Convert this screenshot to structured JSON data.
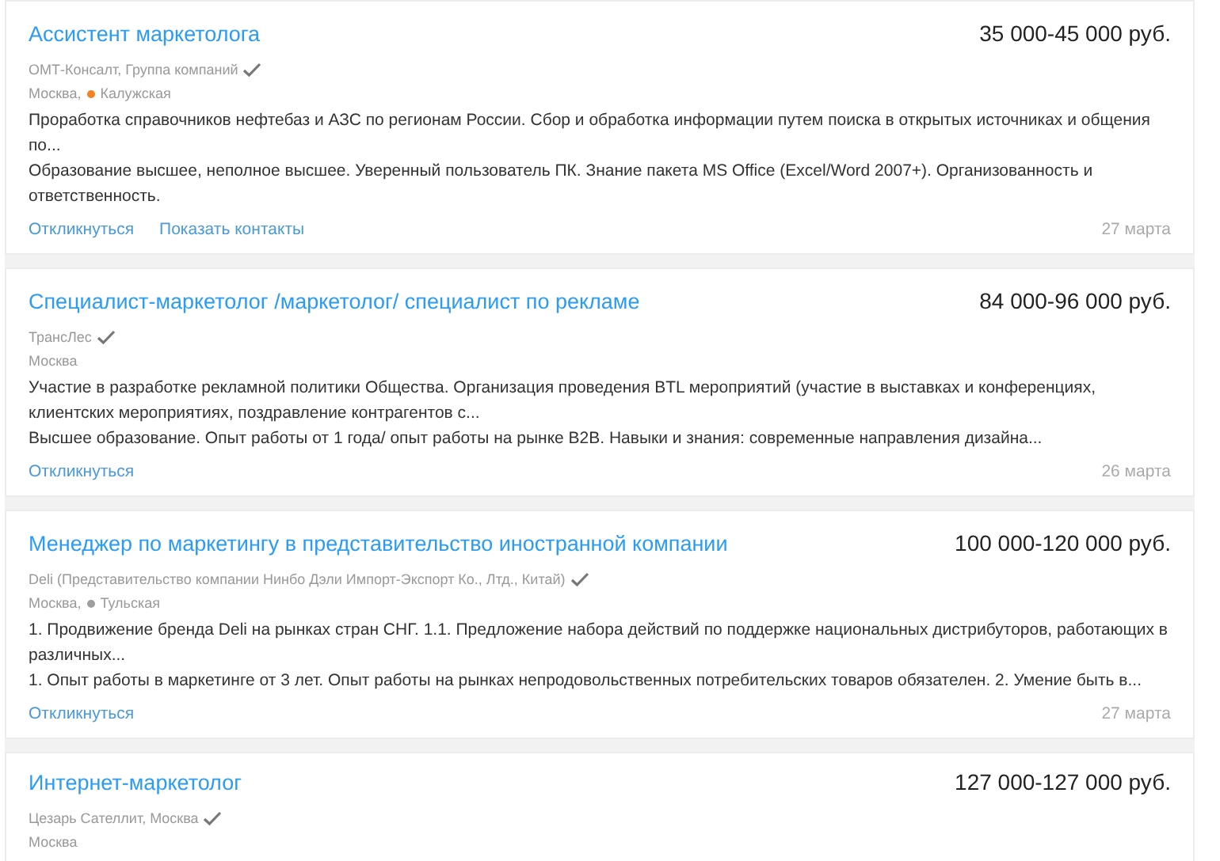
{
  "vacancies": [
    {
      "title": "Ассистент маркетолога",
      "salary": "35 000-45 000 руб.",
      "company": "ОМТ-Консалт, Группа компаний",
      "verified": true,
      "city": "Москва,",
      "metro": {
        "name": "Калужская",
        "color": "#f58220"
      },
      "responsibilities": "Проработка справочников нефтебаз и АЗС по регионам России. Сбор и обработка информации путем поиска в открытых источниках и общения по...",
      "requirements": "Образование высшее, неполное высшее. Уверенный пользователь ПК. Знание пакета MS Office (Excel/Word 2007+). Организованность и ответственность.",
      "actions": [
        "Откликнуться",
        "Показать контакты"
      ],
      "date": "27 марта"
    },
    {
      "title": "Специалист-маркетолог /маркетолог/ специалист по рекламе",
      "salary": "84 000-96 000 руб.",
      "company": "ТрансЛес",
      "verified": true,
      "city": "Москва",
      "responsibilities": "Участие в разработке рекламной политики Общества. Организация проведения BTL мероприятий (участие в выставках и конференциях, клиентских мероприятиях, поздравление контрагентов с...",
      "requirements": "Высшее образование. Опыт работы от 1 года/ опыт работы на рынке B2B. Навыки и знания: современные направления дизайна...",
      "actions": [
        "Откликнуться"
      ],
      "date": "26 марта"
    },
    {
      "title": "Менеджер по маркетингу в представительство иностранной компании",
      "salary": "100 000-120 000 руб.",
      "company": "Deli (Представительство компании Нинбо Дэли Импорт-Экспорт Ко., Лтд., Китай)",
      "verified": true,
      "city": "Москва,",
      "metro": {
        "name": "Тульская",
        "color": "#9e9e9e"
      },
      "responsibilities": "1. Продвижение бренда Deli на рынках стран СНГ. 1.1. Предложение набора действий по поддержке национальных дистрибуторов, работающих в различных...",
      "requirements": "1. Опыт работы в маркетинге от 3 лет. Опыт работы на рынках непродовольственных потребительских товаров обязателен. 2. Умение быть в...",
      "actions": [
        "Откликнуться"
      ],
      "date": "27 марта"
    },
    {
      "title": "Интернет-маркетолог",
      "salary": "127 000-127 000 руб.",
      "company": "Цезарь Сателлит, Москва",
      "verified": true,
      "city": "Москва"
    }
  ]
}
